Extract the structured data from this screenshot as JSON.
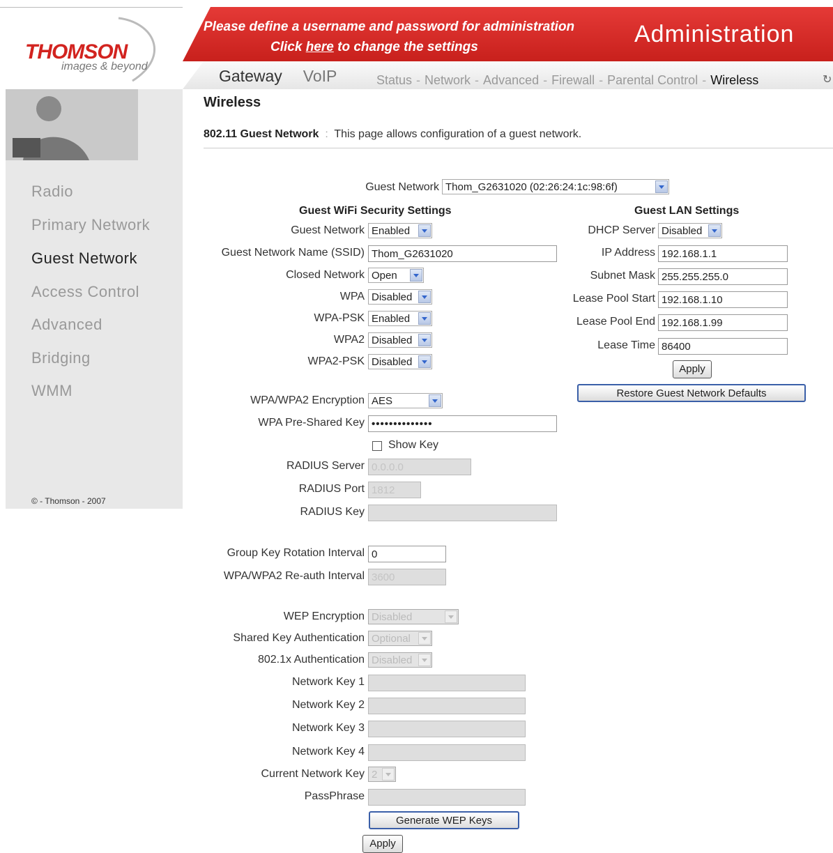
{
  "brand": {
    "name": "THOMSON",
    "tagline": "images & beyond"
  },
  "banner": {
    "line1": "Please define a username and password for administration",
    "line2_pre": "Click ",
    "line2_link": "here",
    "line2_post": " to change the settings",
    "title": "Administration"
  },
  "nav": {
    "main": [
      "Gateway",
      "VoIP"
    ],
    "sub": [
      "Status",
      "Network",
      "Advanced",
      "Firewall",
      "Parental Control",
      "Wireless"
    ],
    "sub_current": "Wireless",
    "refresh_icon": "refresh-icon"
  },
  "sidebar": {
    "items": [
      {
        "label": "Radio",
        "active": false
      },
      {
        "label": "Primary Network",
        "active": false
      },
      {
        "label": "Guest Network",
        "active": true
      },
      {
        "label": "Access Control",
        "active": false
      },
      {
        "label": "Advanced",
        "active": false
      },
      {
        "label": "Bridging",
        "active": false
      },
      {
        "label": "WMM",
        "active": false
      }
    ],
    "copyright": "© - Thomson - 2007"
  },
  "page": {
    "heading": "Wireless",
    "desc_bold": "802.11 Guest Network",
    "desc_sep": ":",
    "desc_text": "This page allows configuration of a guest network.",
    "guest_network_label": "Guest Network",
    "guest_network_value": "Thom_G2631020 (02:26:24:1c:98:6f)"
  },
  "security": {
    "title": "Guest WiFi Security Settings",
    "guest_network": {
      "label": "Guest Network",
      "value": "Enabled"
    },
    "ssid": {
      "label": "Guest Network Name (SSID)",
      "value": "Thom_G2631020"
    },
    "closed_network": {
      "label": "Closed Network",
      "value": "Open"
    },
    "wpa": {
      "label": "WPA",
      "value": "Disabled"
    },
    "wpa_psk": {
      "label": "WPA-PSK",
      "value": "Enabled"
    },
    "wpa2": {
      "label": "WPA2",
      "value": "Disabled"
    },
    "wpa2_psk": {
      "label": "WPA2-PSK",
      "value": "Disabled"
    },
    "encryption": {
      "label": "WPA/WPA2 Encryption",
      "value": "AES"
    },
    "psk": {
      "label": "WPA Pre-Shared Key",
      "value": "••••••••••••••"
    },
    "show_key": {
      "label": "Show Key"
    },
    "radius_server": {
      "label": "RADIUS Server",
      "value": "0.0.0.0"
    },
    "radius_port": {
      "label": "RADIUS Port",
      "value": "1812"
    },
    "radius_key": {
      "label": "RADIUS Key",
      "value": ""
    },
    "group_key": {
      "label": "Group Key Rotation Interval",
      "value": "0"
    },
    "reauth": {
      "label": "WPA/WPA2 Re-auth Interval",
      "value": "3600"
    },
    "wep_encryption": {
      "label": "WEP Encryption",
      "value": "Disabled"
    },
    "shared_key_auth": {
      "label": "Shared Key Authentication",
      "value": "Optional"
    },
    "dot1x_auth": {
      "label": "802.1x Authentication",
      "value": "Disabled"
    },
    "network_key1": {
      "label": "Network Key 1",
      "value": ""
    },
    "network_key2": {
      "label": "Network Key 2",
      "value": ""
    },
    "network_key3": {
      "label": "Network Key 3",
      "value": ""
    },
    "network_key4": {
      "label": "Network Key 4",
      "value": ""
    },
    "current_key": {
      "label": "Current Network Key",
      "value": "2"
    },
    "passphrase": {
      "label": "PassPhrase",
      "value": ""
    },
    "generate_btn": "Generate WEP Keys",
    "apply_btn": "Apply"
  },
  "lan": {
    "title": "Guest LAN Settings",
    "dhcp": {
      "label": "DHCP Server",
      "value": "Disabled"
    },
    "ip": {
      "label": "IP Address",
      "value": "192.168.1.1"
    },
    "subnet": {
      "label": "Subnet Mask",
      "value": "255.255.255.0"
    },
    "pool_start": {
      "label": "Lease Pool Start",
      "value": "192.168.1.10"
    },
    "pool_end": {
      "label": "Lease Pool End",
      "value": "192.168.1.99"
    },
    "lease_time": {
      "label": "Lease Time",
      "value": "86400"
    },
    "apply_btn": "Apply",
    "restore_btn": "Restore Guest Network Defaults"
  },
  "colors": {
    "brand_red": "#d2231f",
    "banner_red": "#c8201c",
    "sidebar_bg": "#e8e8e8"
  }
}
